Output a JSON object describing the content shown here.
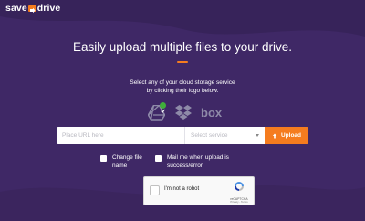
{
  "header": {
    "logo_left": "save",
    "logo_right": "drive"
  },
  "main": {
    "headline": "Easily upload multiple files to your drive.",
    "sub_line1": "Select any of your cloud storage service",
    "sub_line2": "by clicking their logo below.",
    "services": [
      {
        "name": "Google Drive",
        "icon": "google-drive-icon",
        "selected": true
      },
      {
        "name": "Dropbox",
        "icon": "dropbox-icon",
        "selected": false
      },
      {
        "name": "Box",
        "icon": "box-icon",
        "label": "box",
        "selected": false
      }
    ]
  },
  "form": {
    "url_placeholder": "Place URL here",
    "url_value": "",
    "service_placeholder": "Select service",
    "upload_label": "Upload"
  },
  "options": {
    "change_name_line1": "Change file",
    "change_name_line2": "name",
    "mail_line1": "Mail me when upload is",
    "mail_line2": "success/error"
  },
  "recaptcha": {
    "label": "I'm not a robot",
    "brand": "reCAPTCHA",
    "terms": "Privacy - Terms"
  },
  "colors": {
    "background": "#3f2866",
    "accent": "#f57c1f",
    "icon_gray": "#8e8aa8",
    "check_green": "#3fae3a"
  }
}
